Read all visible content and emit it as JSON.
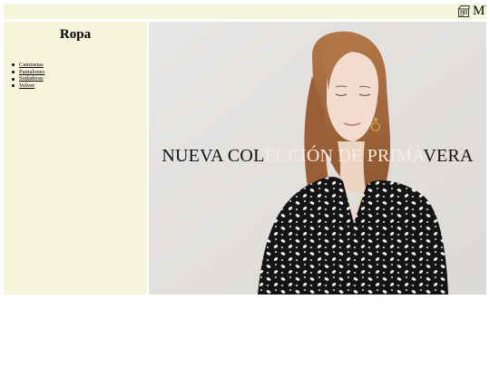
{
  "header": {
    "brand_text": "MU",
    "brand_icon": "shop-icon"
  },
  "sidebar": {
    "title": "Ropa",
    "items": [
      {
        "label": "Camisetas"
      },
      {
        "label": "Pantalones"
      },
      {
        "label": "Sudaderas"
      },
      {
        "label": "Volver"
      }
    ]
  },
  "hero": {
    "caption_part1": "NUEVA COL",
    "caption_part2": "ECCIÓN DE PRIMA",
    "caption_part3": "VERA",
    "colors": {
      "panel_bg": "#f5f5dc",
      "photo_bg": "#e4e2e0",
      "dress": "#141414",
      "hair": "#a86a3c"
    }
  }
}
